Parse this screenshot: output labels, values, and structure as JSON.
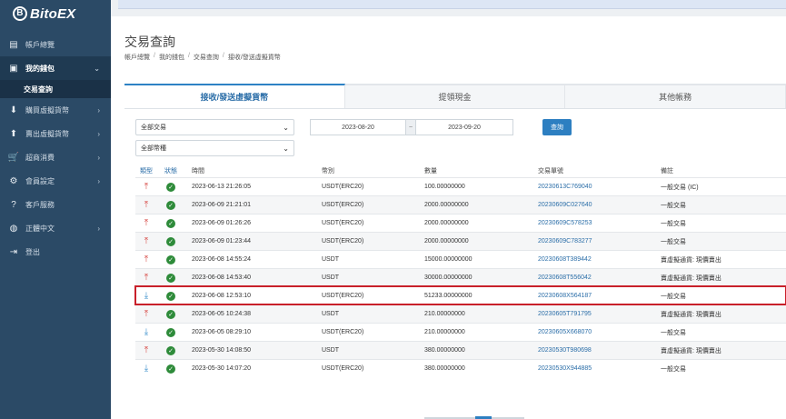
{
  "brand": {
    "name": "BitoEX",
    "mark": "B"
  },
  "sidebar": {
    "items": [
      {
        "label": "帳戶總覽",
        "icon": "dashboard-icon",
        "glyph": "▤",
        "chev": ""
      },
      {
        "label": "我的錢包",
        "icon": "wallet-icon",
        "glyph": "▣",
        "chev": "⌄",
        "active": true
      },
      {
        "label": "購買虛擬貨幣",
        "icon": "download-circle-icon",
        "glyph": "⬇",
        "chev": "›"
      },
      {
        "label": "賣出虛擬貨幣",
        "icon": "upload-circle-icon",
        "glyph": "⬆",
        "chev": "›"
      },
      {
        "label": "超商消費",
        "icon": "cart-icon",
        "glyph": "🛒",
        "chev": "›"
      },
      {
        "label": "會員設定",
        "icon": "gear-icon",
        "glyph": "⚙",
        "chev": "›"
      },
      {
        "label": "客戶服務",
        "icon": "help-icon",
        "glyph": "?",
        "chev": ""
      },
      {
        "label": "正體中文",
        "icon": "globe-icon",
        "glyph": "◍",
        "chev": "›"
      },
      {
        "label": "登出",
        "icon": "logout-icon",
        "glyph": "⇥",
        "chev": ""
      }
    ],
    "sub_item": "交易查詢"
  },
  "page": {
    "title": "交易查詢",
    "breadcrumb": [
      "帳戶總覽",
      "我的錢包",
      "交易查詢",
      "接收/發送虛擬貨幣"
    ]
  },
  "tabs": [
    "接收/發送虛擬貨幣",
    "提領現金",
    "其他帳務"
  ],
  "filters": {
    "trade_type": "全部交易",
    "coin_type": "全部幣種",
    "date_from": "2023-08-20",
    "date_sep": "~",
    "date_to": "2023-09-20",
    "query_label": "查詢"
  },
  "table": {
    "headers": [
      "類型",
      "狀態",
      "時間",
      "幣別",
      "數量",
      "交易單號",
      "備註"
    ],
    "rows": [
      {
        "dir": "out",
        "time": "2023-06-13 21:26:05",
        "coin": "USDT(ERC20)",
        "amount": "100.00000000",
        "tx": "20230613C769040",
        "note": "一般交易 (IC)"
      },
      {
        "dir": "out",
        "time": "2023-06-09 21:21:01",
        "coin": "USDT(ERC20)",
        "amount": "2000.00000000",
        "tx": "20230609C027640",
        "note": "一般交易"
      },
      {
        "dir": "out",
        "time": "2023-06-09 01:26:26",
        "coin": "USDT(ERC20)",
        "amount": "2000.00000000",
        "tx": "20230609C578253",
        "note": "一般交易"
      },
      {
        "dir": "out",
        "time": "2023-06-09 01:23:44",
        "coin": "USDT(ERC20)",
        "amount": "2000.00000000",
        "tx": "20230609C783277",
        "note": "一般交易"
      },
      {
        "dir": "out",
        "time": "2023-06-08 14:55:24",
        "coin": "USDT",
        "amount": "15000.00000000",
        "tx": "20230608T389442",
        "note": "賣虛擬通貨: 現價賣出"
      },
      {
        "dir": "out",
        "time": "2023-06-08 14:53:40",
        "coin": "USDT",
        "amount": "30000.00000000",
        "tx": "20230608T556042",
        "note": "賣虛擬通貨: 現價賣出"
      },
      {
        "dir": "in",
        "time": "2023-06-08 12:53:10",
        "coin": "USDT(ERC20)",
        "amount": "51233.00000000",
        "tx": "20230608X564187",
        "note": "一般交易",
        "highlight": true
      },
      {
        "dir": "out",
        "time": "2023-06-05 10:24:38",
        "coin": "USDT",
        "amount": "210.00000000",
        "tx": "20230605T791795",
        "note": "賣虛擬通貨: 現價賣出"
      },
      {
        "dir": "in",
        "time": "2023-06-05 08:29:10",
        "coin": "USDT(ERC20)",
        "amount": "210.00000000",
        "tx": "20230605X668070",
        "note": "一般交易"
      },
      {
        "dir": "out",
        "time": "2023-05-30 14:08:50",
        "coin": "USDT",
        "amount": "380.00000000",
        "tx": "20230530T980698",
        "note": "賣虛擬通貨: 現價賣出"
      },
      {
        "dir": "in",
        "time": "2023-05-30 14:07:20",
        "coin": "USDT(ERC20)",
        "amount": "380.00000000",
        "tx": "20230530X944885",
        "note": "一般交易"
      }
    ]
  },
  "colors": {
    "sidebar": "#2b4a66",
    "accent": "#2d7fc1",
    "highlight": "#c8202a",
    "ok": "#2e8b3a"
  }
}
